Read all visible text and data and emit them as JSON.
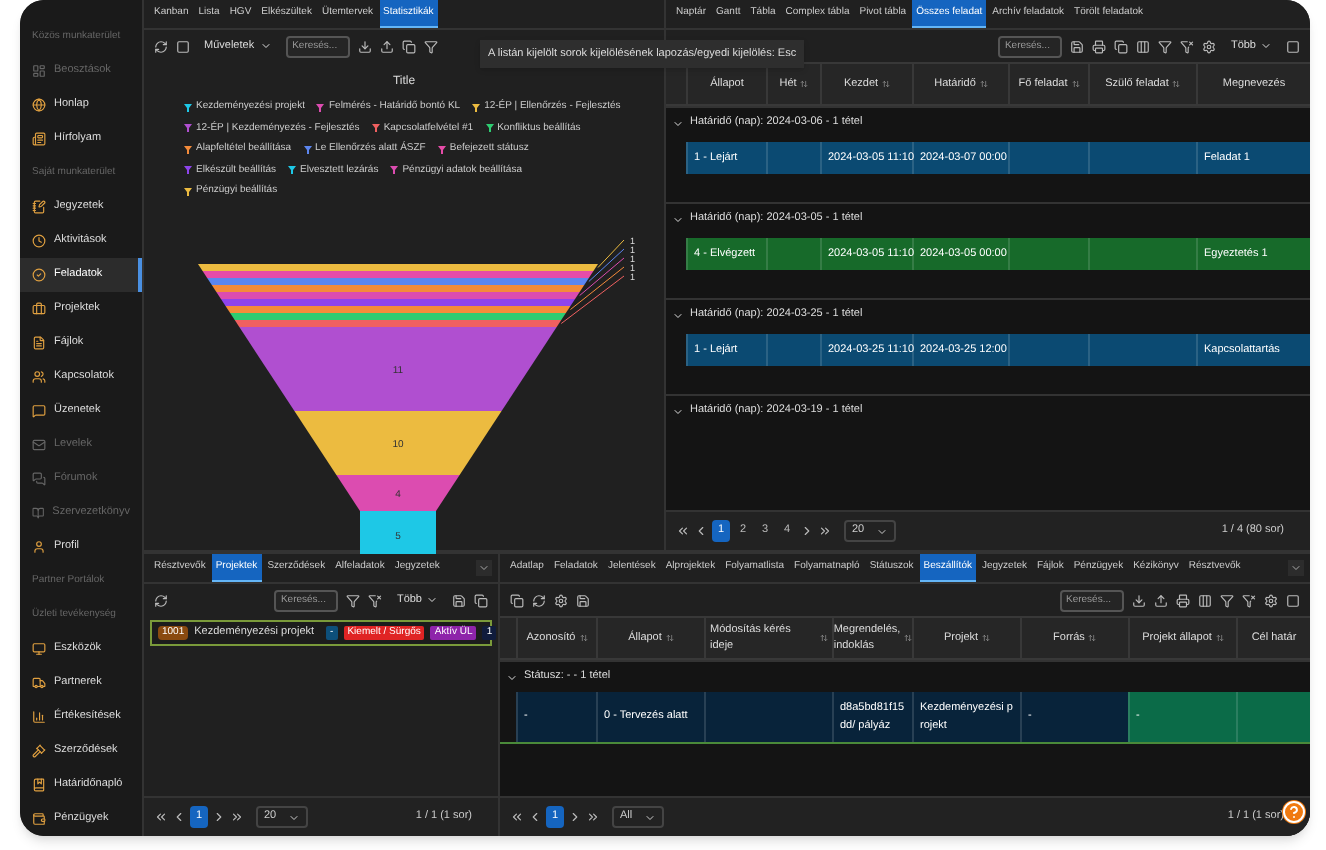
{
  "sidebar": [
    {
      "kind": "header",
      "label": "Közös munkaterület"
    },
    {
      "kind": "item",
      "label": "Beosztások",
      "selected": false,
      "disabled": true
    },
    {
      "kind": "item",
      "label": "Honlap",
      "selected": false,
      "disabled": false
    },
    {
      "kind": "item",
      "label": "Hírfolyam",
      "selected": false,
      "disabled": false
    },
    {
      "kind": "header",
      "label": "Saját munkaterület"
    },
    {
      "kind": "item",
      "label": "Jegyzetek",
      "selected": false,
      "disabled": false
    },
    {
      "kind": "item",
      "label": "Aktivitások",
      "selected": false,
      "disabled": false
    },
    {
      "kind": "item",
      "label": "Feladatok",
      "selected": true,
      "disabled": false
    },
    {
      "kind": "item",
      "label": "Projektek",
      "selected": false,
      "disabled": false
    },
    {
      "kind": "item",
      "label": "Fájlok",
      "selected": false,
      "disabled": false
    },
    {
      "kind": "item",
      "label": "Kapcsolatok",
      "selected": false,
      "disabled": false
    },
    {
      "kind": "item",
      "label": "Üzenetek",
      "selected": false,
      "disabled": false
    },
    {
      "kind": "item",
      "label": "Levelek",
      "selected": false,
      "disabled": true
    },
    {
      "kind": "item",
      "label": "Fórumok",
      "selected": false,
      "disabled": true
    },
    {
      "kind": "item",
      "label": "Szervezetkönyv",
      "selected": false,
      "disabled": true
    },
    {
      "kind": "item",
      "label": "Profil",
      "selected": false,
      "disabled": false
    },
    {
      "kind": "header",
      "label": "Partner Portálok"
    },
    {
      "kind": "header",
      "label": "Üzleti tevékenység"
    },
    {
      "kind": "item",
      "label": "Eszközök",
      "selected": false,
      "disabled": false
    },
    {
      "kind": "item",
      "label": "Partnerek",
      "selected": false,
      "disabled": false
    },
    {
      "kind": "item",
      "label": "Értékesítések",
      "selected": false,
      "disabled": false
    },
    {
      "kind": "item",
      "label": "Szerződések",
      "selected": false,
      "disabled": false
    },
    {
      "kind": "item",
      "label": "Határidőnapló",
      "selected": false,
      "disabled": false
    },
    {
      "kind": "item",
      "label": "Pénzügyek",
      "selected": false,
      "disabled": false
    }
  ],
  "stats_panel": {
    "tabs": [
      {
        "label": "Kanban",
        "selected": false
      },
      {
        "label": "Lista",
        "selected": false
      },
      {
        "label": "HGV",
        "selected": false
      },
      {
        "label": "Elkészültek",
        "selected": false
      },
      {
        "label": "Ütemtervek",
        "selected": false
      },
      {
        "label": "Statisztikák",
        "selected": true
      }
    ],
    "actions": "Műveletek",
    "search": {
      "placeholder": "Keresés..."
    },
    "tooltip": "A listán kijelölt sorok kijelölésének lapozás/egyedi kijelölés:  Esc",
    "chart_title": "Title",
    "legend": [
      {
        "label": "Kezdeményezési projekt",
        "color": "#1ec8e6"
      },
      {
        "label": "Felmérés - Határidő bontó KL",
        "color": "#dc4cb0"
      },
      {
        "label": "12-ÉP | Ellenőrzés - Fejlesztés",
        "color": "#ecbb40"
      },
      {
        "label": "12-ÉP | Kezdeményezés - Fejlesztés",
        "color": "#b04fd0"
      },
      {
        "label": "Kapcsolatfelvétel #1",
        "color": "#f06060"
      },
      {
        "label": "Konfliktus beállítás",
        "color": "#2ecc71"
      },
      {
        "label": "Alapfeltétel beállítása",
        "color": "#f48b3a"
      },
      {
        "label": "Le Ellenőrzés alatt ÁSZF",
        "color": "#5c86f0"
      },
      {
        "label": "Befejezett státusz",
        "color": "#e64ca8"
      },
      {
        "label": "Elkészült beállítás",
        "color": "#8e44ec"
      },
      {
        "label": "Elvesztett lezárás",
        "color": "#1ec8e6"
      },
      {
        "label": "Pénzügyi adatok beállítása",
        "color": "#dc4cb0"
      },
      {
        "label": "Pénzügyi beállítás",
        "color": "#ecbb40"
      }
    ],
    "funnel": [
      {
        "kind": "thin",
        "color": "#ecbb40",
        "label": "1"
      },
      {
        "kind": "thin",
        "color": "#e64ca8"
      },
      {
        "kind": "thin",
        "color": "#5c86f0",
        "label": "1"
      },
      {
        "kind": "thin",
        "color": "#f48b3a"
      },
      {
        "kind": "thin",
        "color": "#dc4cb0",
        "label": "1"
      },
      {
        "kind": "thin",
        "color": "#8e44ec"
      },
      {
        "kind": "thin",
        "color": "#f48b3a",
        "label": "1"
      },
      {
        "kind": "thin",
        "color": "#2ecc71"
      },
      {
        "kind": "thin",
        "color": "#f06060",
        "label": "1"
      },
      {
        "kind": "wide",
        "color": "#b04fd0",
        "label": "11"
      },
      {
        "kind": "wide",
        "color": "#ecbb40",
        "label": "10"
      },
      {
        "kind": "wide",
        "color": "#dc4cb0",
        "label": "4"
      },
      {
        "kind": "wide",
        "color": "#1ec8e6",
        "label": "5"
      }
    ]
  },
  "tasks_panel": {
    "tabs": [
      {
        "label": "Naptár",
        "selected": false
      },
      {
        "label": "Gantt",
        "selected": false
      },
      {
        "label": "Tábla",
        "selected": false
      },
      {
        "label": "Complex tábla",
        "selected": false
      },
      {
        "label": "Pivot tábla",
        "selected": false
      },
      {
        "label": "Összes feladat",
        "selected": true
      },
      {
        "label": "Archív feladatok",
        "selected": false
      },
      {
        "label": "Törölt feladatok",
        "selected": false
      }
    ],
    "search": {
      "placeholder": "Keresés..."
    },
    "more": "Több",
    "columns": [
      "Állapot",
      "Hét",
      "Kezdet",
      "Határidő",
      "Fő feladat",
      "Szülő feladat",
      "Megnevezés"
    ],
    "groups": [
      {
        "label": "Határidő (nap): 2024-03-06 - 1 tétel",
        "expanded": true,
        "rows": [
          {
            "color": "#0b4a72",
            "cells": [
              "1 - Lejárt",
              "",
              "2024-03-05 11:10",
              "2024-03-07 00:00",
              "",
              "",
              "Feladat 1"
            ]
          }
        ]
      },
      {
        "label": "Határidő (nap): 2024-03-05 - 1 tétel",
        "expanded": true,
        "rows": [
          {
            "color": "#176a2a",
            "cells": [
              "4 - Elvégzett",
              "",
              "2024-03-05 11:10",
              "2024-03-05 00:00",
              "",
              "",
              "Egyeztetés 1"
            ]
          }
        ]
      },
      {
        "label": "Határidő (nap): 2024-03-25 - 1 tétel",
        "expanded": true,
        "rows": [
          {
            "color": "#0b4a72",
            "cells": [
              "1 - Lejárt",
              "",
              "2024-03-25 11:10",
              "2024-03-25 12:00",
              "",
              "",
              "Kapcsolattartás"
            ]
          }
        ]
      },
      {
        "label": "Határidő (nap): 2024-03-19 - 1 tétel",
        "expanded": true
      }
    ],
    "pager": {
      "pages": [
        {
          "label": "1",
          "selected": true
        },
        {
          "label": "2",
          "selected": false
        },
        {
          "label": "3",
          "selected": false
        },
        {
          "label": "4",
          "selected": false
        }
      ],
      "page_size": "20",
      "summary": "1 / 4 (80 sor)"
    }
  },
  "projects_panel": {
    "tabs": [
      {
        "label": "Résztvevők",
        "selected": false
      },
      {
        "label": "Projektek",
        "selected": true
      },
      {
        "label": "Szerződések",
        "selected": false
      },
      {
        "label": "Alfeladatok",
        "selected": false
      },
      {
        "label": "Jegyzetek",
        "selected": false
      }
    ],
    "search": {
      "placeholder": "Keresés..."
    },
    "more": "Több",
    "items": [
      {
        "code": "1001",
        "name": "Kezdeményezési projekt",
        "selected": true,
        "badges": [
          {
            "text": "-",
            "color": "#0d4f7a"
          },
          {
            "text": "Kiemelt / Sürgős",
            "color": "#e02424"
          },
          {
            "text": "Aktív ÜL",
            "color": "#8e24aa"
          },
          {
            "text": "1",
            "color": "#101c3c"
          }
        ]
      }
    ],
    "pager": {
      "pages": [
        {
          "label": "1",
          "selected": true
        }
      ],
      "page_size": "20",
      "summary": "1 / 1 (1 sor)"
    }
  },
  "suppliers_panel": {
    "tabs": [
      {
        "label": "Adatlap",
        "selected": false
      },
      {
        "label": "Feladatok",
        "selected": false
      },
      {
        "label": "Jelentések",
        "selected": false
      },
      {
        "label": "Alprojektek",
        "selected": false
      },
      {
        "label": "Folyamatlista",
        "selected": false
      },
      {
        "label": "Folyamatnapló",
        "selected": false
      },
      {
        "label": "Státuszok",
        "selected": false
      },
      {
        "label": "Beszállítók",
        "selected": true
      },
      {
        "label": "Jegyzetek",
        "selected": false
      },
      {
        "label": "Fájlok",
        "selected": false
      },
      {
        "label": "Pénzügyek",
        "selected": false
      },
      {
        "label": "Kézikönyv",
        "selected": false
      },
      {
        "label": "Résztvevők",
        "selected": false
      }
    ],
    "search": {
      "placeholder": "Keresés..."
    },
    "columns": [
      "Azonosító",
      "Állapot",
      "Módosítás kérés ideje",
      "Megrendelés, indoklás",
      "Projekt",
      "Forrás",
      "Projekt állapot",
      "Cél határ"
    ],
    "groups": [
      {
        "label": "Státusz: - - 1 tétel",
        "expanded": true,
        "rows": [
          {
            "color": "#08233a",
            "cells": [
              {
                "text": "-"
              },
              {
                "text": "0 - Tervezés alatt"
              },
              {},
              {
                "text": "d8a5bd81f15dd/ pályáz"
              },
              {
                "text": "Kezdeményezési projekt"
              },
              {
                "text": "-"
              },
              {
                "text": "-",
                "color": "#0b6b48"
              },
              {
                "color": "#0b6b48"
              }
            ]
          }
        ]
      }
    ],
    "pager": {
      "pages": [
        {
          "label": "1",
          "selected": true
        }
      ],
      "page_size": "All",
      "summary": "1 / 1 (1 sor)"
    }
  }
}
